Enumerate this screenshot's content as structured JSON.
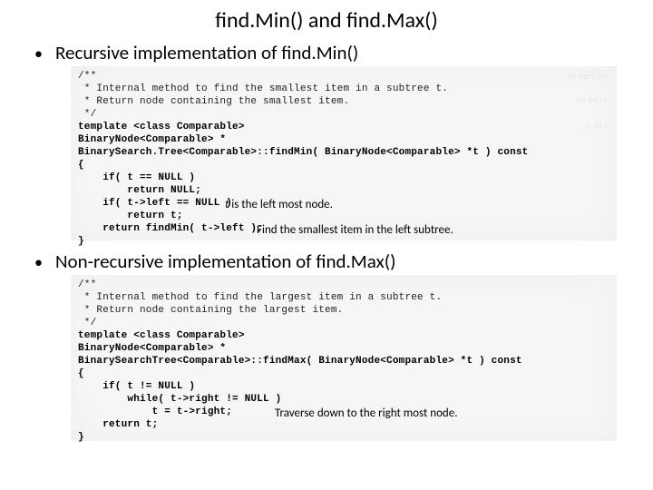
{
  "title": "find.Min() and find.Max()",
  "bullets": {
    "recursive": "Recursive implementation of find.Min()",
    "nonrecursive": "Non-recursive implementation of find.Max()"
  },
  "code": {
    "findmin": {
      "c1": "/**",
      "c2": " * Internal method to find the smallest item in a subtree t.",
      "c3": " * Return node containing the smallest item.",
      "c4": " */",
      "l1": "template <class Comparable>",
      "l2": "BinaryNode<Comparable> *",
      "l3": "BinarySearch.Tree<Comparable>::findMin( BinaryNode<Comparable> *t ) const",
      "l4": "{",
      "l5": "    if( t == NULL )",
      "l6": "        return NULL;",
      "l7": "    if( t->left == NULL )",
      "l8": "        return t;",
      "l9": "    return findMin( t->left );",
      "l10": "}"
    },
    "findmax": {
      "c1": "/**",
      "c2": " * Internal method to find the largest item in a subtree t.",
      "c3": " * Return node containing the largest item.",
      "c4": " */",
      "l1": "template <class Comparable>",
      "l2": "BinaryNode<Comparable> *",
      "l3": "BinarySearchTree<Comparable>::findMax( BinaryNode<Comparable> *t ) const",
      "l4": "{",
      "l5": "    if( t != NULL )",
      "l6": "        while( t->right != NULL )",
      "l7": "            t = t->right;",
      "l8": "    return t;",
      "l9": "}"
    }
  },
  "annotations": {
    "t_is_left": "is the left most node.",
    "t_letter": "t ",
    "find_smallest": "Find the smallest item in the left subtree.",
    "traverse_right": "Traverse down to the right most node."
  }
}
